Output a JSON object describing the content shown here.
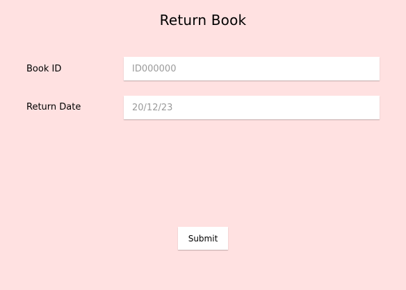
{
  "page": {
    "title": "Return Book"
  },
  "form": {
    "book_id": {
      "label": "Book ID",
      "placeholder": "ID000000",
      "value": ""
    },
    "return_date": {
      "label": "Return Date",
      "placeholder": "20/12/23",
      "value": ""
    },
    "submit_label": "Submit"
  },
  "colors": {
    "background": "#ffe1e1",
    "input_background": "#ffffff",
    "placeholder_text": "#9a9a9a"
  }
}
